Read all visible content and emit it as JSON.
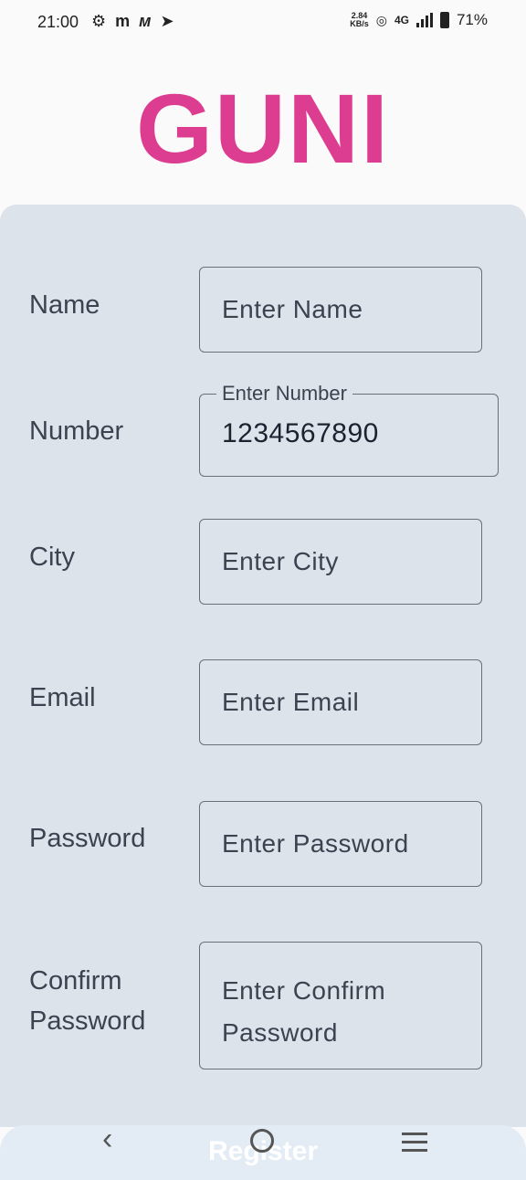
{
  "status_bar": {
    "time": "21:00",
    "left_icons": [
      "settings-icon",
      "m-icon",
      "m-icon",
      "telegram-icon"
    ],
    "speed_value": "2.84",
    "speed_unit": "KB/s",
    "network": "4G",
    "battery": "71%"
  },
  "app": {
    "logo": "GUNI"
  },
  "form": {
    "name": {
      "label": "Name",
      "placeholder": "Enter Name",
      "value": ""
    },
    "number": {
      "label": "Number",
      "floating_label": "Enter Number",
      "value": "1234567890"
    },
    "city": {
      "label": "City",
      "placeholder": "Enter City",
      "value": ""
    },
    "email": {
      "label": "Email",
      "placeholder": "Enter Email",
      "value": ""
    },
    "password": {
      "label": "Password",
      "placeholder": "Enter Password",
      "value": ""
    },
    "confirm_password": {
      "label_line1": "Confirm",
      "label_line2": "Password",
      "placeholder_line1": "Enter Confirm",
      "placeholder_line2": "Password",
      "value": ""
    },
    "register_label": "Register"
  },
  "nav": {
    "icons": [
      "back-icon",
      "home-icon",
      "menu-icon"
    ]
  },
  "colors": {
    "brand": "#dc3d90",
    "card": "#dde3ea"
  }
}
